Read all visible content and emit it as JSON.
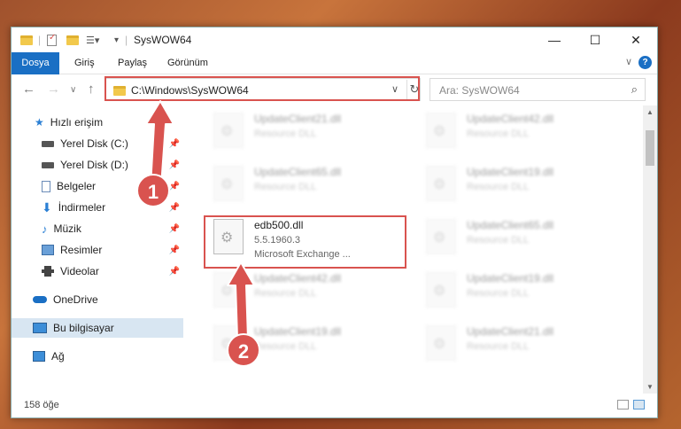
{
  "window": {
    "title": "SysWOW64"
  },
  "window_controls": {
    "minimize": "—",
    "maximize": "☐",
    "close": "✕"
  },
  "ribbon": {
    "file_tab": "Dosya",
    "tabs": [
      "Giriş",
      "Paylaş",
      "Görünüm"
    ],
    "help": "?"
  },
  "address": {
    "path": "C:\\Windows\\SysWOW64"
  },
  "search": {
    "placeholder": "Ara: SysWOW64"
  },
  "sidebar": {
    "items": [
      {
        "label": "Hızlı erişim",
        "icon": "star-icon",
        "pinned": false
      },
      {
        "label": "Yerel Disk (C:)",
        "icon": "drive-icon",
        "pinned": true
      },
      {
        "label": "Yerel Disk (D:)",
        "icon": "drive-icon",
        "pinned": true
      },
      {
        "label": "Belgeler",
        "icon": "documents-icon",
        "pinned": true
      },
      {
        "label": "İndirmeler",
        "icon": "download-icon",
        "pinned": true
      },
      {
        "label": "Müzik",
        "icon": "music-icon",
        "pinned": true
      },
      {
        "label": "Resimler",
        "icon": "pictures-icon",
        "pinned": true
      },
      {
        "label": "Videolar",
        "icon": "video-icon",
        "pinned": true
      },
      {
        "label": "OneDrive",
        "icon": "cloud-icon",
        "pinned": false
      },
      {
        "label": "Bu bilgisayar",
        "icon": "computer-icon",
        "pinned": false,
        "selected": true
      },
      {
        "label": "Ağ",
        "icon": "network-icon",
        "pinned": false
      }
    ]
  },
  "files": [
    {
      "name": "UpdateClient21.dll",
      "desc": "Resource DLL",
      "blurred": true
    },
    {
      "name": "UpdateClient42.dll",
      "desc": "Resource DLL",
      "blurred": true
    },
    {
      "name": "UpdateClient65.dll",
      "desc": "Resource DLL",
      "blurred": true
    },
    {
      "name": "UpdateClient19.dll",
      "desc": "Resource DLL",
      "blurred": true
    },
    {
      "name": "edb500.dll",
      "desc": "5.5.1960.3",
      "desc2": "Microsoft Exchange ...",
      "blurred": false
    },
    {
      "name": "UpdateClient65.dll",
      "desc": "Resource DLL",
      "blurred": true
    },
    {
      "name": "UpdateClient42.dll",
      "desc": "Resource DLL",
      "blurred": true
    },
    {
      "name": "UpdateClient19.dll",
      "desc": "Resource DLL",
      "blurred": true
    },
    {
      "name": "UpdateClient19.dll",
      "desc": "Resource DLL",
      "blurred": true
    },
    {
      "name": "UpdateClient21.dll",
      "desc": "Resource DLL",
      "blurred": true
    }
  ],
  "status": {
    "count": "158 öğe"
  },
  "annotations": {
    "step1": "1",
    "step2": "2"
  },
  "colors": {
    "accent": "#1a6fc4",
    "highlight": "#d9534f"
  }
}
